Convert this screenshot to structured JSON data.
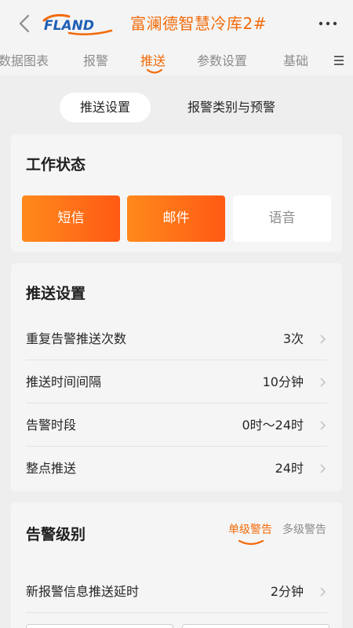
{
  "header": {
    "logo_text": "FLAND",
    "title": "富澜德智慧冷库2#"
  },
  "tabs": [
    {
      "label": "数据图表",
      "active": false
    },
    {
      "label": "报警",
      "active": false
    },
    {
      "label": "推送",
      "active": true
    },
    {
      "label": "参数设置",
      "active": false
    },
    {
      "label": "基础",
      "active": false
    }
  ],
  "segment": {
    "push_settings": "推送设置",
    "alarm_category": "报警类别与预警"
  },
  "work_status": {
    "title": "工作状态",
    "buttons": [
      {
        "label": "短信",
        "active": true
      },
      {
        "label": "邮件",
        "active": true
      },
      {
        "label": "语音",
        "active": false
      }
    ]
  },
  "push_settings": {
    "title": "推送设置",
    "rows": [
      {
        "label": "重复告警推送次数",
        "value": "3次"
      },
      {
        "label": "推送时间间隔",
        "value": "10分钟"
      },
      {
        "label": "告警时段",
        "value": "0时～24时"
      },
      {
        "label": "整点推送",
        "value": "24时"
      }
    ]
  },
  "alarm_level": {
    "title": "告警级别",
    "single": "单级警告",
    "multi": "多级警告",
    "rows": [
      {
        "label": "新报警信息推送延时",
        "value": "2分钟"
      }
    ]
  },
  "colors": {
    "accent": "#f26b0b",
    "button_gradient_start": "#ff8a1c",
    "button_gradient_end": "#ff5a14",
    "logo_blue": "#1f5fb5",
    "logo_orange": "#f26b0b"
  },
  "icons": {
    "back": "chevron-left-icon",
    "more": "more-horizontal-icon",
    "menu": "menu-icon",
    "row": "chevron-right-icon"
  }
}
